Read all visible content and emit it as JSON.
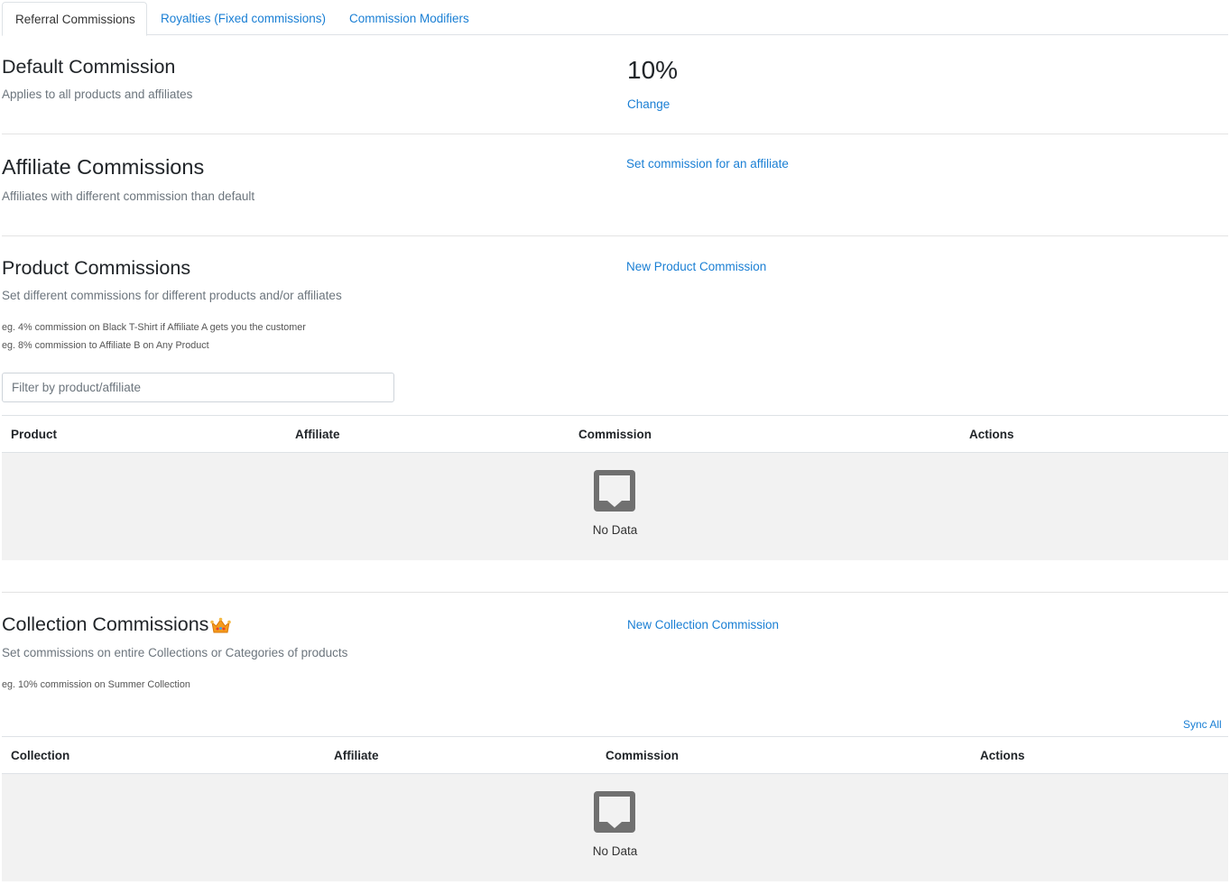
{
  "tabs": [
    {
      "label": "Referral Commissions",
      "active": true
    },
    {
      "label": "Royalties (Fixed commissions)",
      "active": false
    },
    {
      "label": "Commission Modifiers",
      "active": false
    }
  ],
  "default_commission": {
    "title": "Default Commission",
    "subtitle": "Applies to all products and affiliates",
    "value": "10%",
    "change_label": "Change"
  },
  "affiliate_commissions": {
    "title": "Affiliate Commissions",
    "subtitle": "Affiliates with different commission than default",
    "action_label": "Set commission for an affiliate"
  },
  "product_commissions": {
    "title": "Product Commissions",
    "subtitle": "Set different commissions for different products and/or affiliates",
    "examples": [
      "eg. 4% commission on Black T-Shirt if Affiliate A gets you the customer",
      "eg. 8% commission to Affiliate B on Any Product"
    ],
    "action_label": "New Product Commission",
    "filter_placeholder": "Filter by product/affiliate",
    "columns": [
      "Product",
      "Affiliate",
      "Commission",
      "Actions"
    ],
    "empty_text": "No Data",
    "empty_icon": "inbox-icon"
  },
  "collection_commissions": {
    "title": "Collection Commissions",
    "premium_icon": "crown-icon",
    "subtitle": "Set commissions on entire Collections or Categories of products",
    "examples": [
      "eg. 10% commission on Summer Collection"
    ],
    "action_label": "New Collection Commission",
    "sync_label": "Sync All",
    "columns": [
      "Collection",
      "Affiliate",
      "Commission",
      "Actions"
    ],
    "empty_text": "No Data",
    "empty_icon": "inbox-icon"
  },
  "colors": {
    "link": "#1a7fd4",
    "empty_bg": "#f2f2f2",
    "icon_gray": "#707070",
    "crown": "#f59b1b"
  }
}
